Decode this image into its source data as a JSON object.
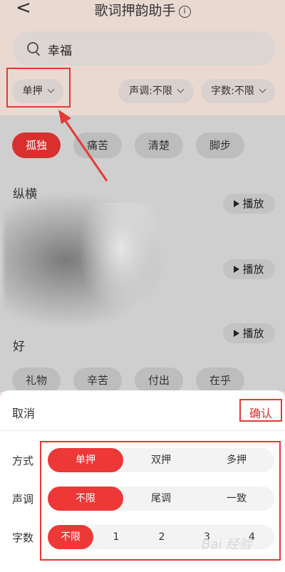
{
  "header": {
    "back_glyph": "<",
    "title": "歌词押韵助手",
    "info_glyph": "i"
  },
  "search": {
    "value": "幸福",
    "icon": "search-icon"
  },
  "filters": {
    "rhyme": "单押",
    "tone": "声调:不限",
    "count": "字数:不限"
  },
  "tags": [
    "孤独",
    "痛苦",
    "清楚",
    "脚步"
  ],
  "results": {
    "play_label": "播放",
    "partial_text_1": "纵横",
    "partial_text_3": "好"
  },
  "tags_bottom": [
    "礼物",
    "辛苦",
    "付出",
    "在乎"
  ],
  "sheet": {
    "cancel": "取消",
    "confirm": "确认",
    "rows": [
      {
        "label": "方式",
        "options": [
          "单押",
          "双押",
          "多押"
        ],
        "selected": "单押"
      },
      {
        "label": "声调",
        "options": [
          "不限",
          "尾调",
          "一致"
        ],
        "selected": "不限"
      },
      {
        "label": "字数",
        "options": [
          "不限",
          "1",
          "2",
          "3",
          "4"
        ],
        "selected": "不限"
      }
    ]
  },
  "watermark": "Bai 经验",
  "colors": {
    "accent": "#ee3737",
    "highlight_border": "#e53935"
  }
}
